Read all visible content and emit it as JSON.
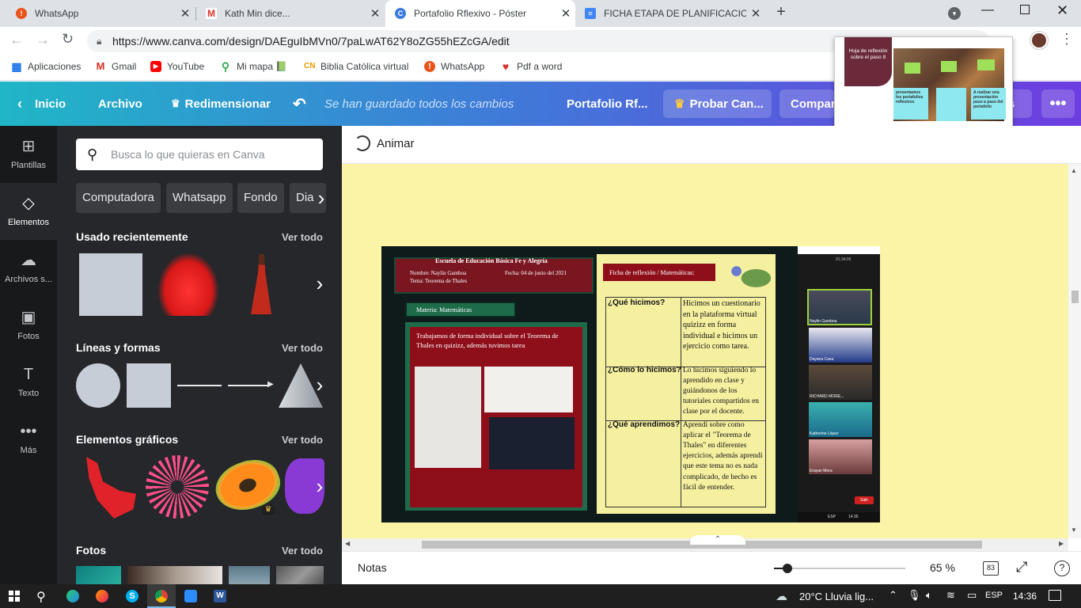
{
  "browser": {
    "tabs": [
      {
        "title": "WhatsApp",
        "color": "#e8541b"
      },
      {
        "title": "Kath Min dice...",
        "color": "#d93025"
      },
      {
        "title": "Portafolio Rflexivo - Póster",
        "color": "#3c7be0"
      },
      {
        "title": "FICHA ETAPA DE PLANIFICACION",
        "color": "#4285f4"
      }
    ],
    "url": "https://www.canva.com/design/DAEguIbMVn0/7paLwAT62Y8oZG55hEZcGA/edit",
    "bookmarks": [
      {
        "label": "Aplicaciones",
        "color": "#5f6368"
      },
      {
        "label": "Gmail",
        "color": "#d93025"
      },
      {
        "label": "YouTube",
        "color": "#ff0000"
      },
      {
        "label": "Mi mapa 📗",
        "color": "#34a853"
      },
      {
        "label": "Biblia Católica virtual",
        "color": "#f29900"
      },
      {
        "label": "WhatsApp",
        "color": "#e8541b"
      },
      {
        "label": "Pdf a word",
        "color": "#d93025"
      }
    ]
  },
  "canva_header": {
    "home": "Inicio",
    "file": "Archivo",
    "resize": "Redimensionar",
    "saved_status": "Se han guardado todos los cambios",
    "doc_title": "Portafolio Rf...",
    "try_pro": "Probar Can...",
    "share": "Compart",
    "share_tail": "rs"
  },
  "rail": [
    {
      "label": "Plantillas",
      "icon": "template-icon"
    },
    {
      "label": "Elementos",
      "icon": "elements-icon"
    },
    {
      "label": "Archivos s...",
      "icon": "upload-icon"
    },
    {
      "label": "Fotos",
      "icon": "photo-icon"
    },
    {
      "label": "Texto",
      "icon": "text-icon"
    },
    {
      "label": "Más",
      "icon": "more-icon"
    }
  ],
  "panel": {
    "search_placeholder": "Busca lo que quieras en Canva",
    "chips": [
      "Computadora",
      "Whatsapp",
      "Fondo",
      "Dia"
    ],
    "sections": {
      "recent": "Usado recientemente",
      "lines": "Líneas y formas",
      "graphics": "Elementos gráficos",
      "photos": "Fotos"
    },
    "see_all": "Ver todo"
  },
  "toolbar": {
    "animate": "Animar"
  },
  "poster": {
    "school": "Escuela de Educación Básica Fe y Alegría",
    "name": "Nombre: Naylin Gamboa",
    "date": "Fecha: 04 de junio del 2021",
    "topic": "Tema: Teorema de Thales",
    "subject": "Materia: Matemáticas",
    "work": "Trabajamos de forma individual sobre el Teorema de Thales en quizizz, además tuvimos tarea",
    "card_title": "Ficha de reflexión / Matemáticas:",
    "rows": [
      {
        "q": "¿Qué hicimos?",
        "a": "Hicimos un cuestionario en la plataforma virtual quizizz en forma individual e hicimos un ejercicio como tarea."
      },
      {
        "q": "¿Cómo lo hicimos?",
        "a": "Lo hicimos siguiendo lo aprendido en clase y guiándonos de los tutoriales compartidos en clase por el docente."
      },
      {
        "q": "¿Qué aprendimos?",
        "a": "Aprendí sobre como aplicar el \"Teorema de Thales\" en diferentes ejercicios, además aprendí que este tema no es nada complicado, de hecho es fácil de entender."
      }
    ],
    "participants": [
      "Naylin Gamboa",
      "Dayana Casa",
      "RICHARD MORE...",
      "Katherine López",
      "Erayan Mora"
    ],
    "call_time": "01:34:05",
    "leave": "Salir",
    "tray_lang": "ESP",
    "tray_time": "14:35"
  },
  "thumbnail": {
    "title": "Hoja de reflexión sobre el paso 8",
    "box1": "presentamos los portafolios reflexivos",
    "box3": "A realizar una presentación paso a paso del portafolio"
  },
  "footer": {
    "notes": "Notas",
    "zoom": "65 %",
    "page_count": "83"
  },
  "taskbar": {
    "weather": "20°C  Lluvia lig...",
    "lang": "ESP",
    "time": "14:36"
  }
}
